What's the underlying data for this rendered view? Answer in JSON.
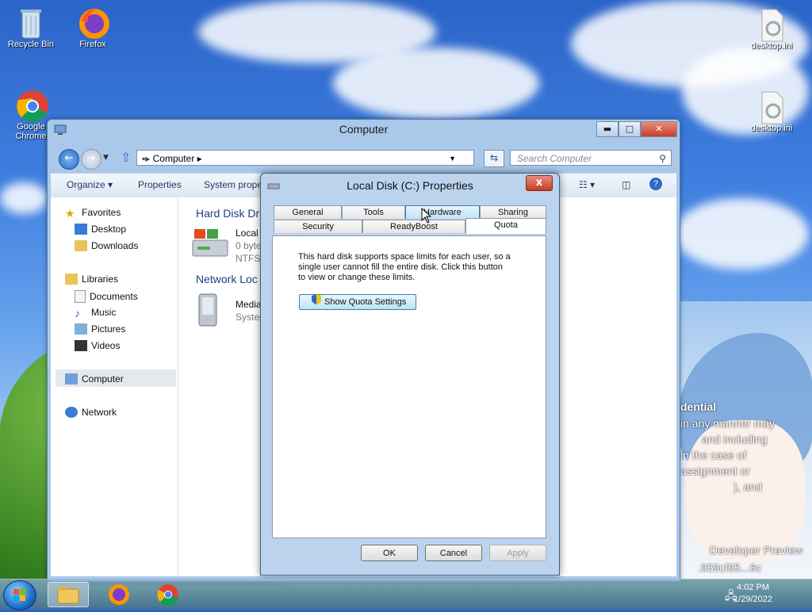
{
  "desktop": {
    "icons": [
      {
        "label": "Recycle Bin",
        "icon": "recycle-bin-icon"
      },
      {
        "label": "Firefox",
        "icon": "firefox-icon"
      },
      {
        "label": "Google Chrome",
        "icon": "chrome-icon"
      },
      {
        "label": "desktop.ini",
        "icon": "settings-file-icon"
      },
      {
        "label": "desktop.ini",
        "icon": "settings-file-icon"
      }
    ],
    "watermark": {
      "line1": "dential",
      "line2": "in any manner may",
      "line3": "and including",
      "line4": "in the case of",
      "line5": "assignment or",
      "line6": "), and",
      "line7": "Developer Preview",
      "line8": ".959cf95...6c"
    }
  },
  "explorer": {
    "title": "Computer",
    "address": "Computer",
    "search_placeholder": "Search Computer",
    "toolbar": {
      "organize": "Organize",
      "properties": "Properties",
      "system_properties": "System prope"
    },
    "nav": {
      "favorites": "Favorites",
      "desktop": "Desktop",
      "downloads": "Downloads",
      "libraries": "Libraries",
      "documents": "Documents",
      "music": "Music",
      "pictures": "Pictures",
      "videos": "Videos",
      "computer": "Computer",
      "network": "Network"
    },
    "content": {
      "hard_disk_group": "Hard Disk Dr",
      "drive_name": "Local",
      "drive_free": "0 byte",
      "drive_fs": "NTFS",
      "network_group": "Network Loc",
      "media_name": "Media",
      "media_sub": "Systen"
    }
  },
  "dialog": {
    "title": "Local Disk (C:) Properties",
    "close_glyph": "x",
    "tabs_row1": [
      "General",
      "Tools",
      "Hardware",
      "Sharing"
    ],
    "tabs_row2": [
      "Security",
      "ReadyBoost",
      "Quota"
    ],
    "active_tab": "Quota",
    "description": "This hard disk supports space limits for each user, so a single user cannot fill the entire disk. Click this button to view or change these limits.",
    "quota_button": "Show Quota Settings",
    "ok": "OK",
    "cancel": "Cancel",
    "apply": "Apply"
  },
  "taskbar": {
    "time": "4:02 PM",
    "date": "1/29/2022"
  }
}
